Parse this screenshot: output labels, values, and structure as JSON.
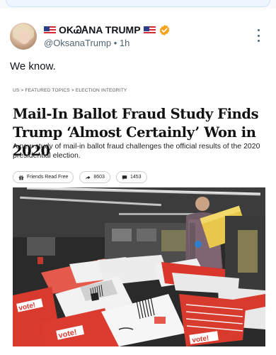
{
  "author": {
    "display_name": "OKᏊᎪNA TRUMP",
    "flag_left": "us-flag-icon",
    "flag_right": "us-flag-icon",
    "handle": "@OksanaTrump",
    "time": "1h"
  },
  "tweet": {
    "text": "We know."
  },
  "article": {
    "breadcrumb": [
      "US",
      "FEATURED TOPICS",
      "ELECTION INTEGRITY"
    ],
    "headline": "Mail-In Ballot Fraud Study Finds Trump ‘Almost Certainly’ Won in 2020",
    "subhead": "A new study of mail-in ballot fraud challenges the official results of the 2020 presidential election.",
    "actions": {
      "friends_read_free": "Friends Read Free",
      "shares": "8603",
      "comments": "1453"
    },
    "photo_labels": [
      "vote!",
      "vote!",
      "vote!"
    ]
  },
  "colors": {
    "verified": "#f9a31a",
    "flag_red": "#d62a35",
    "flag_blue": "#2b3f8a",
    "envelope_red": "#d93a2e"
  }
}
